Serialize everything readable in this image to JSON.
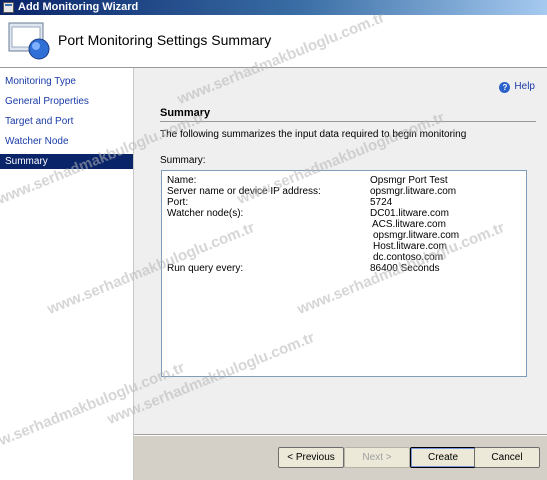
{
  "window": {
    "title": "Add Monitoring Wizard"
  },
  "header": {
    "title": "Port Monitoring Settings Summary"
  },
  "sidebar": {
    "items": [
      {
        "label": "Monitoring Type"
      },
      {
        "label": "General Properties"
      },
      {
        "label": "Target and Port"
      },
      {
        "label": "Watcher Node"
      },
      {
        "label": "Summary",
        "selected": true
      }
    ]
  },
  "main": {
    "help_label": "Help",
    "section_title": "Summary",
    "description": "The following summarizes the input data required to begin monitoring",
    "summary_label": "Summary:",
    "summary": {
      "rows": [
        {
          "label": "Name:",
          "value": "Opsmgr Port Test"
        },
        {
          "label": "Server name or device IP address:",
          "value": "opsmgr.litware.com"
        },
        {
          "label": "Port:",
          "value": "5724"
        },
        {
          "label": "Watcher node(s):",
          "value": "DC01.litware.com"
        },
        {
          "label": "",
          "value": "ACS.litware.com"
        },
        {
          "label": "",
          "value": "opsmgr.litware.com"
        },
        {
          "label": "",
          "value": "Host.litware.com"
        },
        {
          "label": "",
          "value": "dc.contoso.com"
        },
        {
          "label": "Run query every:",
          "value": "86400 Seconds"
        }
      ]
    }
  },
  "buttons": {
    "previous": "< Previous",
    "next": "Next >",
    "create": "Create",
    "cancel": "Cancel"
  },
  "watermark": "www.serhadmakbuloglu.com.tr",
  "colors": {
    "selected_bg": "#0a246a",
    "link": "#1a3ba8"
  }
}
